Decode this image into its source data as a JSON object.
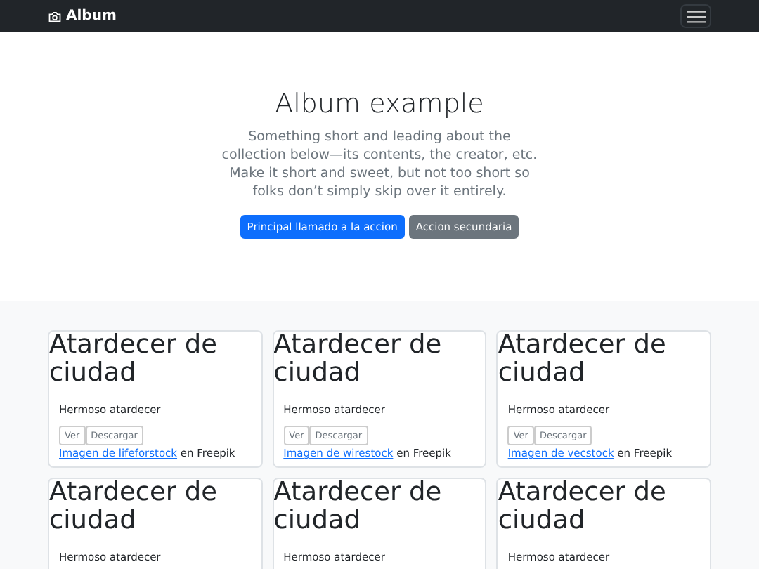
{
  "navbar": {
    "brand": "Album"
  },
  "hero": {
    "title": "Album example",
    "lead": "Something short and leading about the collection below—its contents, the creator, etc. Make it short and sweet, but not too short so folks don’t simply skip over it entirely.",
    "buttons": [
      {
        "label": "Principal llamado a la accion",
        "kind": "primary"
      },
      {
        "label": "Accion secundaria",
        "kind": "secondary"
      }
    ]
  },
  "cards": [
    {
      "title": "Atardecer de ciudad",
      "text": "Hermoso atardecer",
      "buttons": [
        "Ver",
        "Descargar"
      ],
      "link": "Imagen de lifeforstock",
      "suffix": "en Freepik"
    },
    {
      "title": "Atardecer de ciudad",
      "text": "Hermoso atardecer",
      "buttons": [
        "Ver",
        "Descargar"
      ],
      "link": "Imagen de wirestock",
      "suffix": "en Freepik"
    },
    {
      "title": "Atardecer de ciudad",
      "text": "Hermoso atardecer",
      "buttons": [
        "Ver",
        "Descargar"
      ],
      "link": "Imagen de vecstock",
      "suffix": "en Freepik"
    },
    {
      "title": "Atardecer de ciudad",
      "text": "Hermoso atardecer"
    },
    {
      "title": "Atardecer de ciudad",
      "text": "Hermoso atardecer"
    },
    {
      "title": "Atardecer de ciudad",
      "text": "Hermoso atardecer"
    }
  ]
}
